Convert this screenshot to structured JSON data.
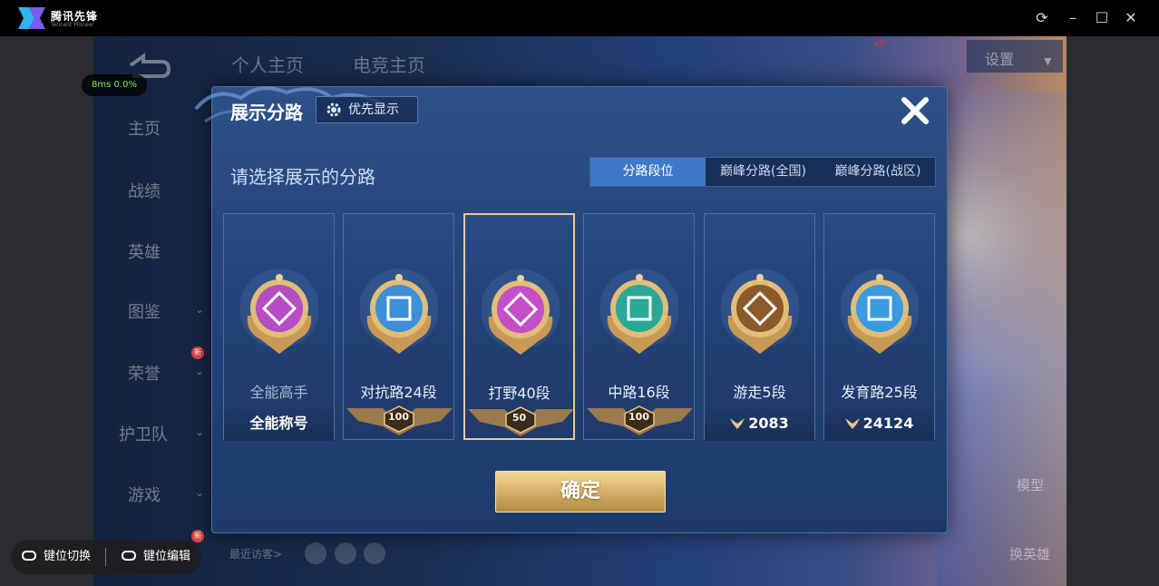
{
  "window": {
    "app_title": "腾讯先锋",
    "app_subtitle": "Tencent Pioneer",
    "controls": [
      "refresh-icon",
      "minimize-icon",
      "maximize-icon",
      "close-icon"
    ]
  },
  "perf": {
    "text": "8ms 0.0%"
  },
  "background": {
    "top_tabs": [
      "个人主页",
      "电竞主页"
    ],
    "settings_label": "设置",
    "nav": [
      "主页",
      "战绩",
      "英雄",
      "图鉴",
      "荣誉",
      "护卫队",
      "游戏"
    ],
    "new_badge": "新",
    "recent_visitors_label": "最近访客>",
    "model_label": "模型",
    "switch_hero_label": "换英雄"
  },
  "modal": {
    "title": "展示分路",
    "priority_button": "优先显示",
    "subtitle": "请选择展示的分路",
    "tabs": [
      {
        "label": "分路段位",
        "active": true
      },
      {
        "label": "巅峰分路(全国)",
        "active": false
      },
      {
        "label": "巅峰分路(战区)",
        "active": false
      }
    ],
    "cards": [
      {
        "label": "全能高手",
        "footer": "全能称号",
        "stars": null,
        "score": null,
        "emblem_color": "#b64dc4",
        "selected": false
      },
      {
        "label": "对抗路24段",
        "footer": null,
        "stars": "100",
        "score": null,
        "emblem_color": "#3c8fd8",
        "selected": false
      },
      {
        "label": "打野40段",
        "footer": null,
        "stars": "50",
        "score": null,
        "emblem_color": "#c24fc8",
        "selected": true
      },
      {
        "label": "中路16段",
        "footer": null,
        "stars": "100",
        "score": null,
        "emblem_color": "#2aa896",
        "selected": false
      },
      {
        "label": "游走5段",
        "footer": null,
        "stars": null,
        "score": "2083",
        "emblem_color": "#8a5a2a",
        "selected": false
      },
      {
        "label": "发育路25段",
        "footer": null,
        "stars": null,
        "score": "24124",
        "emblem_color": "#3a9ae0",
        "selected": false
      }
    ],
    "confirm_button": "确定"
  },
  "keybar": {
    "switch_label": "键位切换",
    "edit_label": "键位编辑"
  }
}
